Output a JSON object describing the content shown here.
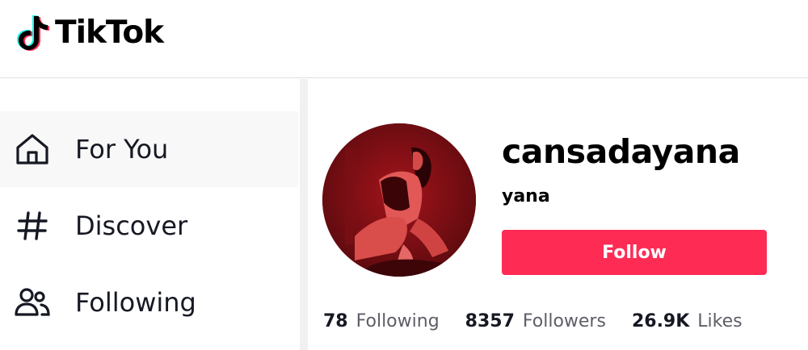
{
  "header": {
    "logo_text": "TikTok"
  },
  "sidebar": {
    "items": [
      {
        "label": "For You",
        "icon": "home-icon",
        "active": true
      },
      {
        "label": "Discover",
        "icon": "hashtag-icon",
        "active": false
      },
      {
        "label": "Following",
        "icon": "users-icon",
        "active": false
      }
    ]
  },
  "profile": {
    "username": "cansadayana",
    "nickname": "yana",
    "follow_label": "Follow",
    "stats": {
      "following_count": "78",
      "following_label": "Following",
      "followers_count": "8357",
      "followers_label": "Followers",
      "likes_count": "26.9K",
      "likes_label": "Likes"
    }
  },
  "colors": {
    "accent": "#fe2c55",
    "text": "#161823",
    "muted": "#5d5e67",
    "active_bg": "#f8f8f8"
  }
}
